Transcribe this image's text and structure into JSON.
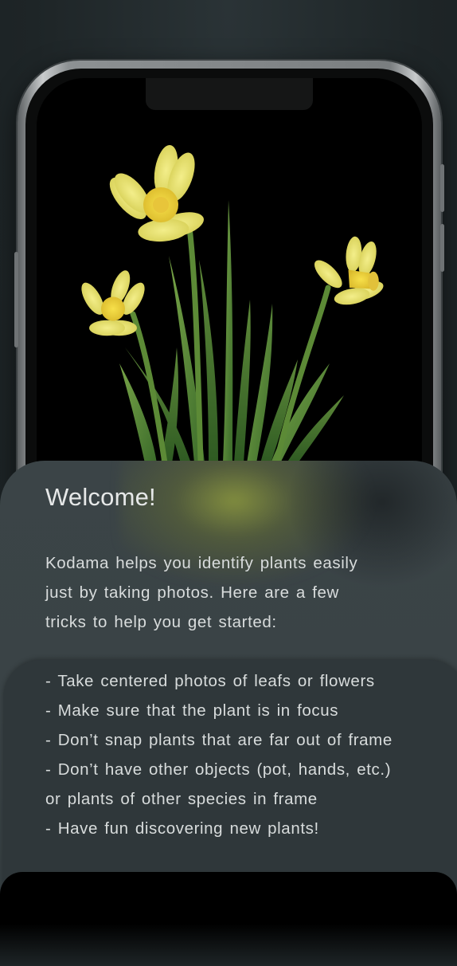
{
  "welcome": {
    "title": "Welcome!",
    "intro_lines": [
      "Kodama helps you identify plants easily",
      "just by taking photos. Here are a few",
      "tricks to help you get started:"
    ]
  },
  "tips": [
    "- Take centered photos of leafs or flowers",
    "- Make sure that the plant is in focus",
    "- Don’t snap plants that are far out of frame",
    "- Don’t have other objects (pot, hands, etc.)",
    "or plants of other species in frame",
    "- Have fun discovering new plants!"
  ],
  "colors": {
    "background": "#1f2628",
    "sheet": "#3b4447",
    "card": "#2f373a",
    "accent_glow": "#8a963e",
    "text": "#d8dcdc"
  },
  "icons": {
    "hero": "daffodil-illustration"
  }
}
